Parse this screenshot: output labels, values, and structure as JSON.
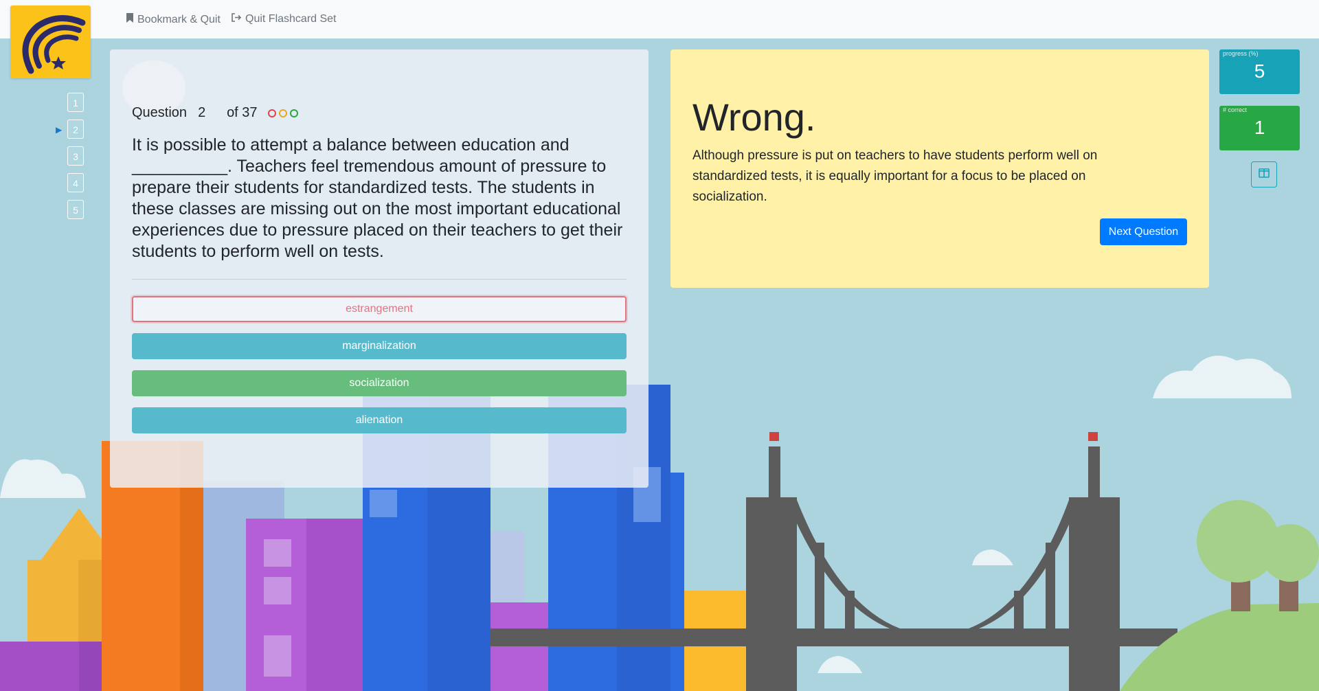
{
  "topbar": {
    "bookmark_label": "Bookmark & Quit",
    "quit_label": "Quit Flashcard Set"
  },
  "nav": {
    "questions": [
      "1",
      "2",
      "3",
      "4",
      "5"
    ],
    "current_marker": "▶"
  },
  "question": {
    "label": "Question",
    "number": "2",
    "of_text": "of 37",
    "text": "It is possible to attempt a balance between education and __________. Teachers feel tremendous amount of pressure to prepare their students for standardized tests. The students in these classes are missing out on the most important educational experiences due to pressure placed on their teachers to get their students to perform well on tests.",
    "answers": [
      {
        "label": "estrangement",
        "state": "wrong"
      },
      {
        "label": "marginalization",
        "state": "neutral"
      },
      {
        "label": "socialization",
        "state": "correct"
      },
      {
        "label": "alienation",
        "state": "neutral"
      }
    ],
    "dots_colors": [
      "#e0434f",
      "#e8a823",
      "#28a745"
    ]
  },
  "feedback": {
    "title": "Wrong.",
    "explanation": "Although pressure is put on teachers to have students perform well on standardized tests, it is equally important for a focus to be placed on socialization.",
    "next_label": "Next Question"
  },
  "stats": {
    "progress_label": "progress (%)",
    "progress_value": "5",
    "correct_label": "# correct",
    "correct_value": "1"
  },
  "colors": {
    "logo_bg": "#fbc21a",
    "logo_mark": "#2b2a6b",
    "wrong": "#e07480",
    "correct": "#66bd7c",
    "info": "#56b9cc",
    "primary": "#007bff",
    "feedback_bg": "#fff2a8"
  },
  "icons": {
    "bookmark": "bookmark-icon",
    "quit": "sign-out-icon",
    "layout": "columns-icon"
  }
}
